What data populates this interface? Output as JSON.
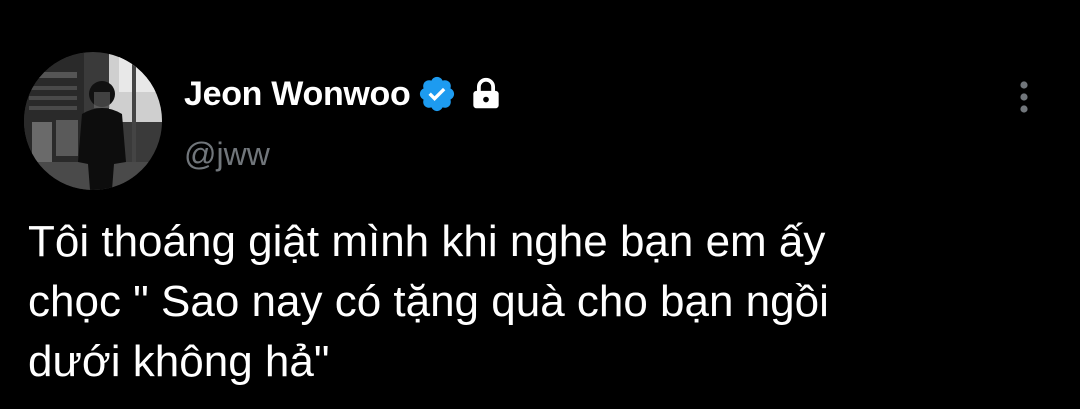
{
  "tweet": {
    "author": {
      "display_name": "Jeon Wonwoo",
      "handle": "@jww",
      "verified_icon": "verified-badge-icon",
      "protected_icon": "lock-icon"
    },
    "more_icon": "more-vertical-icon",
    "text": "Tôi thoáng giật mình khi nghe bạn em ấy\nchọc \" Sao nay có tặng quà cho bạn ngồi\ndưới không hả\""
  },
  "colors": {
    "background": "#000000",
    "text_primary": "#ffffff",
    "text_secondary": "#71767b",
    "verified_blue": "#1d9bf0"
  }
}
